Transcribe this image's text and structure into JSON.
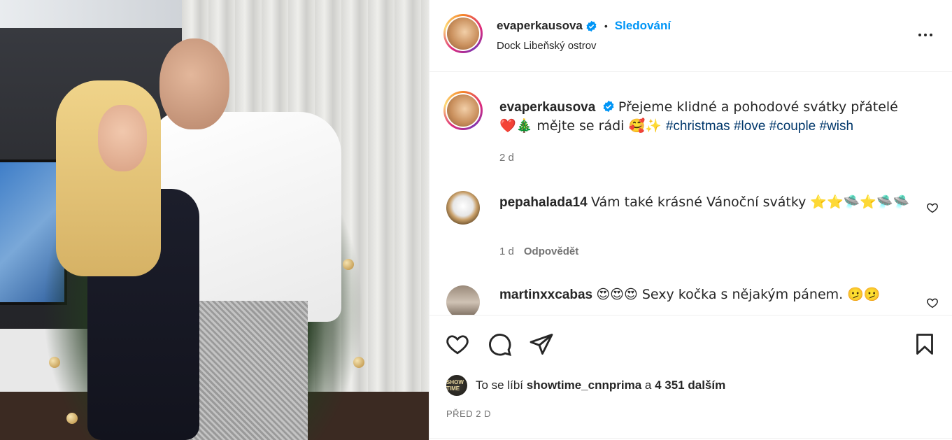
{
  "post": {
    "author": "evaperkausova",
    "follow_label": "Sledování",
    "location": "Dock Libeňský ostrov",
    "more_label": "•••"
  },
  "caption": {
    "author": "evaperkausova",
    "text": "Přejeme klidné a pohodové svátky přátelé ❤️🎄 mějte se rádi 🥰✨ ",
    "hashtags": [
      "#christmas",
      "#love",
      "#couple",
      "#wish"
    ],
    "age": "2 d"
  },
  "comments": [
    {
      "author": "pepahalada14",
      "text": "Vám také krásné Vánoční svátky ⭐⭐🛸⭐🛸🛸",
      "age": "1 d",
      "reply_label": "Odpovědět"
    },
    {
      "author": "martinxxcabas",
      "text": "😍😍😍 Sexy kočka s nějakým pánem. 🫤🫤",
      "age": "",
      "reply_label": ""
    }
  ],
  "likes": {
    "prefix": "To se líbí",
    "user": "showtime_cnnprima",
    "connector": "a",
    "others": "4 351 dalším",
    "mini_avatar_text": "SHOW TIME"
  },
  "date_label": "PŘED 2 D",
  "colors": {
    "link_blue": "#0095f6",
    "hashtag": "#00376b",
    "muted": "#737373",
    "verified": "#0095f6"
  },
  "icons": [
    "verified-badge-icon",
    "more-options-icon",
    "heart-icon",
    "comment-icon",
    "share-icon",
    "bookmark-icon",
    "small-heart-icon"
  ]
}
